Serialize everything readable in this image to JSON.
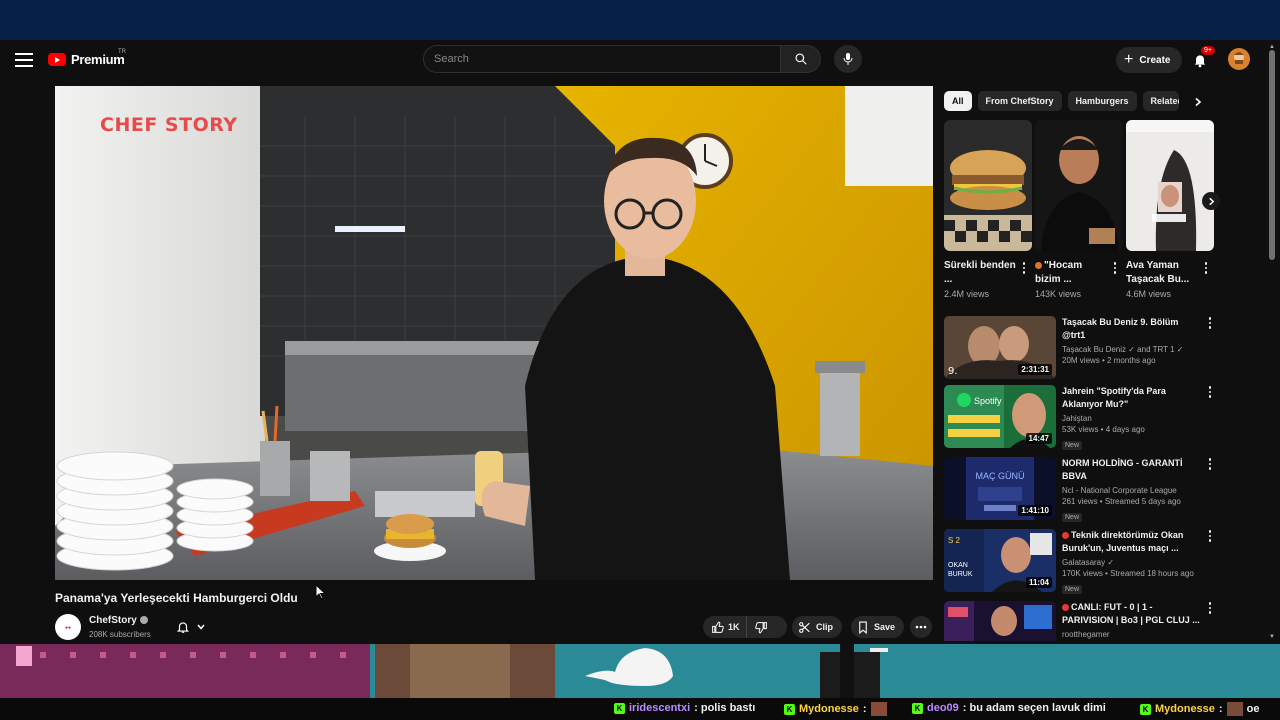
{
  "masthead": {
    "logo_text": "Premium",
    "logo_region": "TR",
    "search_placeholder": "Search",
    "create_label": "Create",
    "notifications_badge": "9+"
  },
  "player": {
    "watermark": "CHEF STORY"
  },
  "video": {
    "title": "Panama'ya Yerleşecekti Hamburgerci Oldu",
    "channel": "ChefStory",
    "subscribers": "208K subscribers",
    "like_count": "1K",
    "clip_label": "Clip",
    "save_label": "Save"
  },
  "chips": [
    {
      "label": "All",
      "active": true
    },
    {
      "label": "From ChefStory",
      "active": false
    },
    {
      "label": "Hamburgers",
      "active": false
    },
    {
      "label": "Related",
      "active": false
    }
  ],
  "shorts": [
    {
      "title": "Sürekli benden ...",
      "views": "2.4M views"
    },
    {
      "title": "\"Hocam bizim ...",
      "views": "143K views",
      "emoji": true
    },
    {
      "title": "Ava Yaman Taşacak Bu...",
      "views": "4.6M views"
    }
  ],
  "recommendations": [
    {
      "title": "Taşacak Bu Deniz 9. Bölüm @trt1",
      "channel": "Taşacak Bu Deniz ✓ and TRT 1 ✓",
      "meta": "20M views • 2 months ago",
      "duration": "2:31:31",
      "new": "",
      "live": false
    },
    {
      "title": "Jahrein \"Spotify'da Para Aklanıyor Mu?\"",
      "channel": "Jahiştan",
      "meta": "53K views • 4 days ago",
      "duration": "14:47",
      "new": "New",
      "live": false
    },
    {
      "title": "NORM HOLDİNG - GARANTİ BBVA",
      "channel": "Ncl - National Corporate League",
      "meta": "261 views • Streamed 5 days ago",
      "duration": "1:41:10",
      "new": "New",
      "live": false
    },
    {
      "title": "Teknik direktörümüz Okan Buruk'un, Juventus maçı ...",
      "channel": "Galatasaray ✓",
      "meta": "170K views • Streamed 18 hours ago",
      "duration": "11:04",
      "new": "New",
      "live": true
    },
    {
      "title": "CANLI: FUT - 0 | 1 - PARIVISION | Bo3 | PGL CLUJ ...",
      "channel": "rootthegamer",
      "meta": "",
      "duration": "",
      "new": "",
      "live": true
    }
  ],
  "chat": [
    {
      "user": "iridescentxi",
      "text": ": polis bastı",
      "color": "#b98cff"
    },
    {
      "user": "Mydonesse",
      "text": ":",
      "color": "#ffd23f"
    },
    {
      "user": "deo09",
      "text": ": bu adam seçen lavuk dimi",
      "color": "#b98cff"
    },
    {
      "user": "Mydonesse",
      "text": ":",
      "color": "#ffd23f"
    },
    {
      "user": "",
      "text": "oe",
      "color": "#ffffff"
    }
  ],
  "colors": {
    "accent_red": "#ff0000",
    "top_bar": "#062048",
    "bg": "#0f0f0f",
    "chat_badge": "#53fc18"
  }
}
